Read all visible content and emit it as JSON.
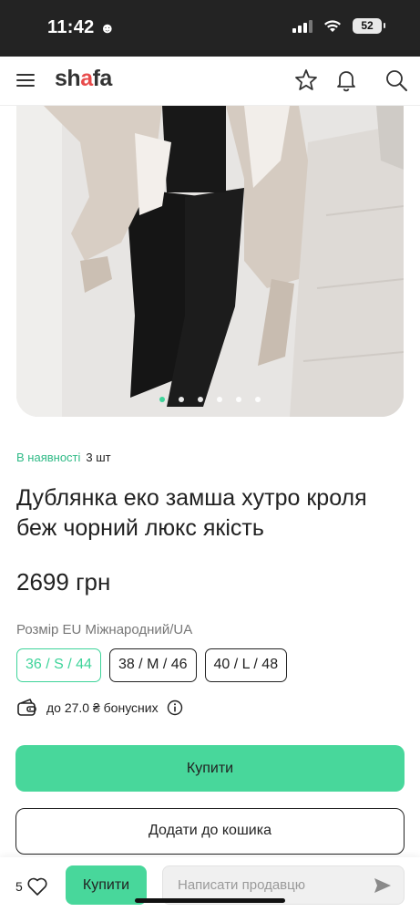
{
  "status_bar": {
    "time": "11:42",
    "battery": "52"
  },
  "header": {
    "logo_prefix": "sh",
    "logo_mark": "a",
    "logo_suffix": "fa"
  },
  "gallery": {
    "image_count": 6,
    "active_index": 0
  },
  "availability": {
    "status": "В наявності",
    "quantity": "3 шт"
  },
  "product": {
    "title": "Дублянка еко замша хутро кроля беж чорний люкс якість",
    "price": "2699 грн",
    "size_label": "Розмір EU Міжнародний/UA",
    "sizes": [
      "36 / S / 44",
      "38 / M / 46",
      "40 / L / 48"
    ],
    "selected_size_index": 0,
    "bonus_text": "до 27.0 ₴ бонусних"
  },
  "actions": {
    "buy": "Купити",
    "add_to_cart": "Додати до кошика"
  },
  "bottom_bar": {
    "likes": "5",
    "buy": "Купити",
    "message_placeholder": "Написати продавцю"
  },
  "colors": {
    "accent": "#48d79b",
    "text": "#222222"
  }
}
